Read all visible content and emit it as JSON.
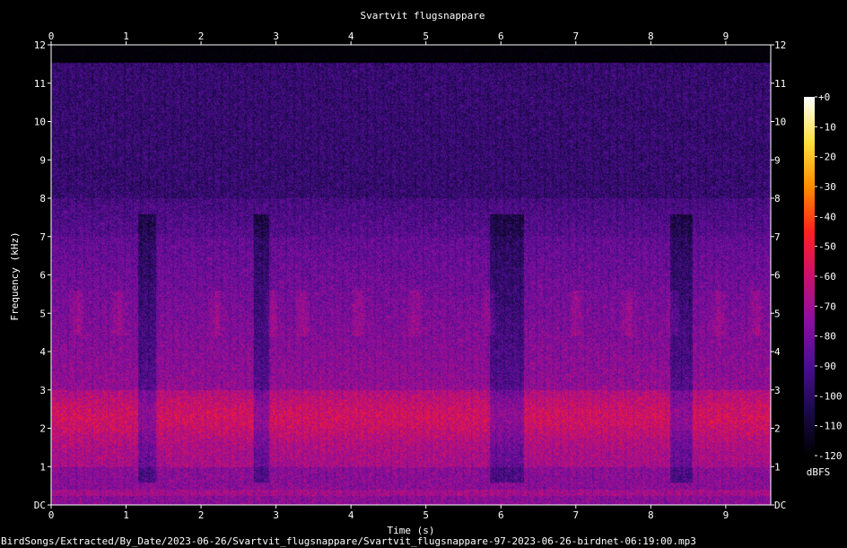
{
  "chart_data": {
    "type": "heatmap",
    "title": "Svartvit flugsnappare",
    "xlabel": "Time (s)",
    "ylabel": "Frequency (kHz)",
    "xlim": [
      0,
      9.6
    ],
    "ylim": [
      0,
      12
    ],
    "x_ticks": [
      "0",
      "1",
      "2",
      "3",
      "4",
      "5",
      "6",
      "7",
      "8",
      "9"
    ],
    "y_ticks": [
      "DC",
      "1",
      "2",
      "3",
      "4",
      "5",
      "6",
      "7",
      "8",
      "9",
      "10",
      "11",
      "12"
    ],
    "colorbar": {
      "label": "dBFS",
      "range": [
        -120,
        0
      ],
      "ticks": [
        "+0",
        "-10",
        "-20",
        "-30",
        "-40",
        "-50",
        "-60",
        "-70",
        "-80",
        "-90",
        "-100",
        "-110",
        "-120"
      ],
      "colors": [
        "#000000",
        "#1a0a4a",
        "#4b0d8f",
        "#8a0fa0",
        "#c8106e",
        "#ff2020",
        "#ff8c00",
        "#ffe040",
        "#ffffff"
      ]
    },
    "quiet_gaps_s": [
      [
        1.15,
        1.4
      ],
      [
        2.7,
        2.9
      ],
      [
        5.85,
        6.3
      ],
      [
        8.25,
        8.55
      ]
    ],
    "bird_call_times_s": [
      0.35,
      0.9,
      2.2,
      2.95,
      3.35,
      4.1,
      4.85,
      5.85,
      7.0,
      7.7,
      8.3,
      8.9,
      9.4
    ]
  },
  "footer": {
    "file_path": "BirdSongs/Extracted/By_Date/2023-06-26/Svartvit_flugsnappare/Svartvit_flugsnappare-97-2023-06-26-birdnet-06:19:00.mp3"
  }
}
